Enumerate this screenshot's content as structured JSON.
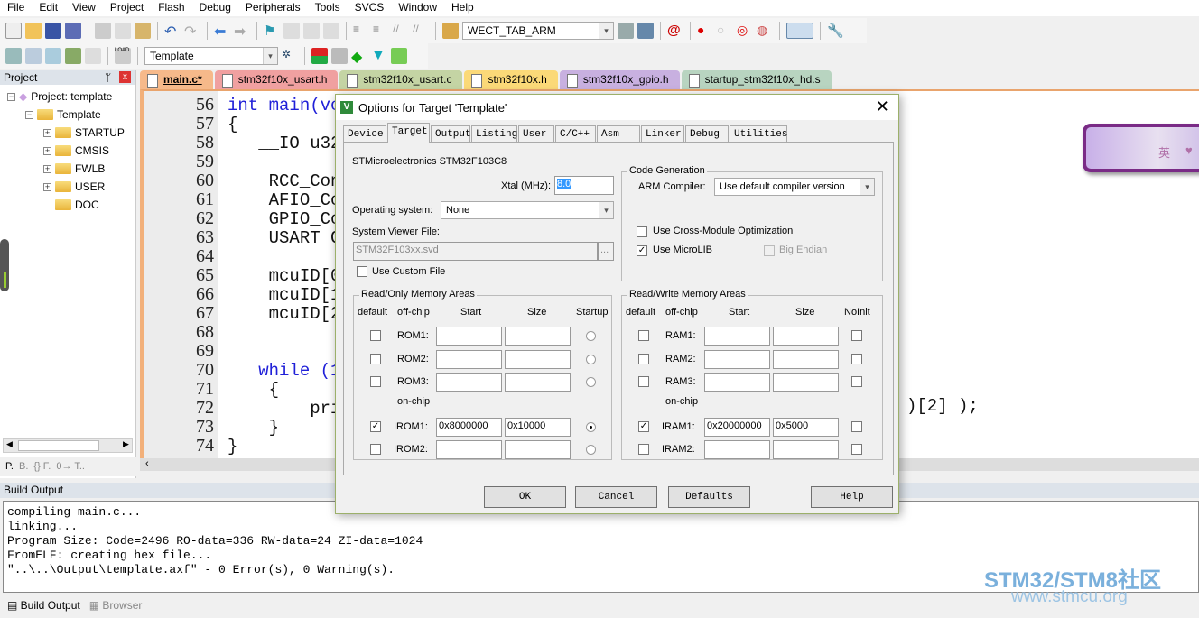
{
  "menu": [
    "File",
    "Edit",
    "View",
    "Project",
    "Flash",
    "Debug",
    "Peripherals",
    "Tools",
    "SVCS",
    "Window",
    "Help"
  ],
  "toolbar": {
    "find_combo": "WECT_TAB_ARM",
    "target_combo": "Template"
  },
  "project": {
    "title": "Project",
    "root": "Project: template",
    "target": "Template",
    "groups": [
      "STARTUP",
      "CMSIS",
      "FWLB",
      "USER",
      "DOC"
    ],
    "bottom_tabs": [
      "P.",
      "B.",
      "{} F.",
      "0→ T.."
    ]
  },
  "file_tabs": [
    {
      "label": "main.c*",
      "color": "#f6b98a"
    },
    {
      "label": "stm32f10x_usart.h",
      "color": "#f0a0a0"
    },
    {
      "label": "stm32f10x_usart.c",
      "color": "#c4d4a4"
    },
    {
      "label": "stm32f10x.h",
      "color": "#fbd978"
    },
    {
      "label": "stm32f10x_gpio.h",
      "color": "#c8b0e0"
    },
    {
      "label": "startup_stm32f10x_hd.s",
      "color": "#b8d4c0"
    }
  ],
  "code": {
    "lines": [
      {
        "n": "56",
        "t": "int main(vo"
      },
      {
        "n": "57",
        "t": "{"
      },
      {
        "n": "58",
        "t": "   __IO u32"
      },
      {
        "n": "59",
        "t": ""
      },
      {
        "n": "60",
        "t": "    RCC_Con"
      },
      {
        "n": "61",
        "t": "    AFIO_Co"
      },
      {
        "n": "62",
        "t": "    GPIO_Co"
      },
      {
        "n": "63",
        "t": "    USART_C"
      },
      {
        "n": "64",
        "t": ""
      },
      {
        "n": "65",
        "t": "    mcuID[0"
      },
      {
        "n": "66",
        "t": "    mcuID[1"
      },
      {
        "n": "67",
        "t": "    mcuID[2"
      },
      {
        "n": "68",
        "t": ""
      },
      {
        "n": "69",
        "t": ""
      },
      {
        "n": "70",
        "t": "   while (1"
      },
      {
        "n": "71",
        "t": "    {"
      },
      {
        "n": "72",
        "t": "        pri"
      },
      {
        "n": "73",
        "t": "    }"
      },
      {
        "n": "74",
        "t": "}"
      }
    ],
    "line72_tail": ")[2] );"
  },
  "ime": {
    "char": "英"
  },
  "dialog": {
    "title": "Options for Target 'Template'",
    "tabs": [
      "Device",
      "Target",
      "Output",
      "Listing",
      "User",
      "C/C++",
      "Asm",
      "Linker",
      "Debug",
      "Utilities"
    ],
    "active_tab": "Target",
    "device": "STMicroelectronics STM32F103C8",
    "xtal_label": "Xtal (MHz):",
    "xtal": "8.0",
    "os_label": "Operating system:",
    "os": "None",
    "svf_label": "System Viewer File:",
    "svf": "STM32F103xx.svd",
    "browse": "...",
    "custom_file": "Use Custom File",
    "codegen": {
      "title": "Code Generation",
      "compiler_label": "ARM Compiler:",
      "compiler": "Use default compiler version",
      "cross_module": "Use Cross-Module Optimization",
      "microlib": "Use MicroLIB",
      "big_endian": "Big Endian"
    },
    "rom": {
      "title": "Read/Only Memory Areas",
      "headers": [
        "default",
        "off-chip",
        "Start",
        "Size",
        "Startup"
      ],
      "onchip": "on-chip",
      "rows": [
        {
          "name": "ROM1:",
          "start": "",
          "size": "",
          "def": false,
          "sel": false
        },
        {
          "name": "ROM2:",
          "start": "",
          "size": "",
          "def": false,
          "sel": false
        },
        {
          "name": "ROM3:",
          "start": "",
          "size": "",
          "def": false,
          "sel": false
        },
        {
          "name": "IROM1:",
          "start": "0x8000000",
          "size": "0x10000",
          "def": true,
          "sel": true
        },
        {
          "name": "IROM2:",
          "start": "",
          "size": "",
          "def": false,
          "sel": false
        }
      ]
    },
    "ram": {
      "title": "Read/Write Memory Areas",
      "headers": [
        "default",
        "off-chip",
        "Start",
        "Size",
        "NoInit"
      ],
      "onchip": "on-chip",
      "rows": [
        {
          "name": "RAM1:",
          "start": "",
          "size": "",
          "def": false
        },
        {
          "name": "RAM2:",
          "start": "",
          "size": "",
          "def": false
        },
        {
          "name": "RAM3:",
          "start": "",
          "size": "",
          "def": false
        },
        {
          "name": "IRAM1:",
          "start": "0x20000000",
          "size": "0x5000",
          "def": true
        },
        {
          "name": "IRAM2:",
          "start": "",
          "size": "",
          "def": false
        }
      ]
    },
    "buttons": {
      "ok": "OK",
      "cancel": "Cancel",
      "defaults": "Defaults",
      "help": "Help"
    }
  },
  "build": {
    "title": "Build Output",
    "lines": [
      "compiling main.c...",
      "linking...",
      "Program Size: Code=2496 RO-data=336 RW-data=24 ZI-data=1024",
      "FromELF: creating hex file...",
      "\"..\\..\\Output\\template.axf\" - 0 Error(s), 0 Warning(s)."
    ],
    "tabs": [
      "Build Output",
      "Browser"
    ]
  },
  "watermark": {
    "main": "STM32/STM8社区",
    "url": "www.stmcu.org"
  }
}
